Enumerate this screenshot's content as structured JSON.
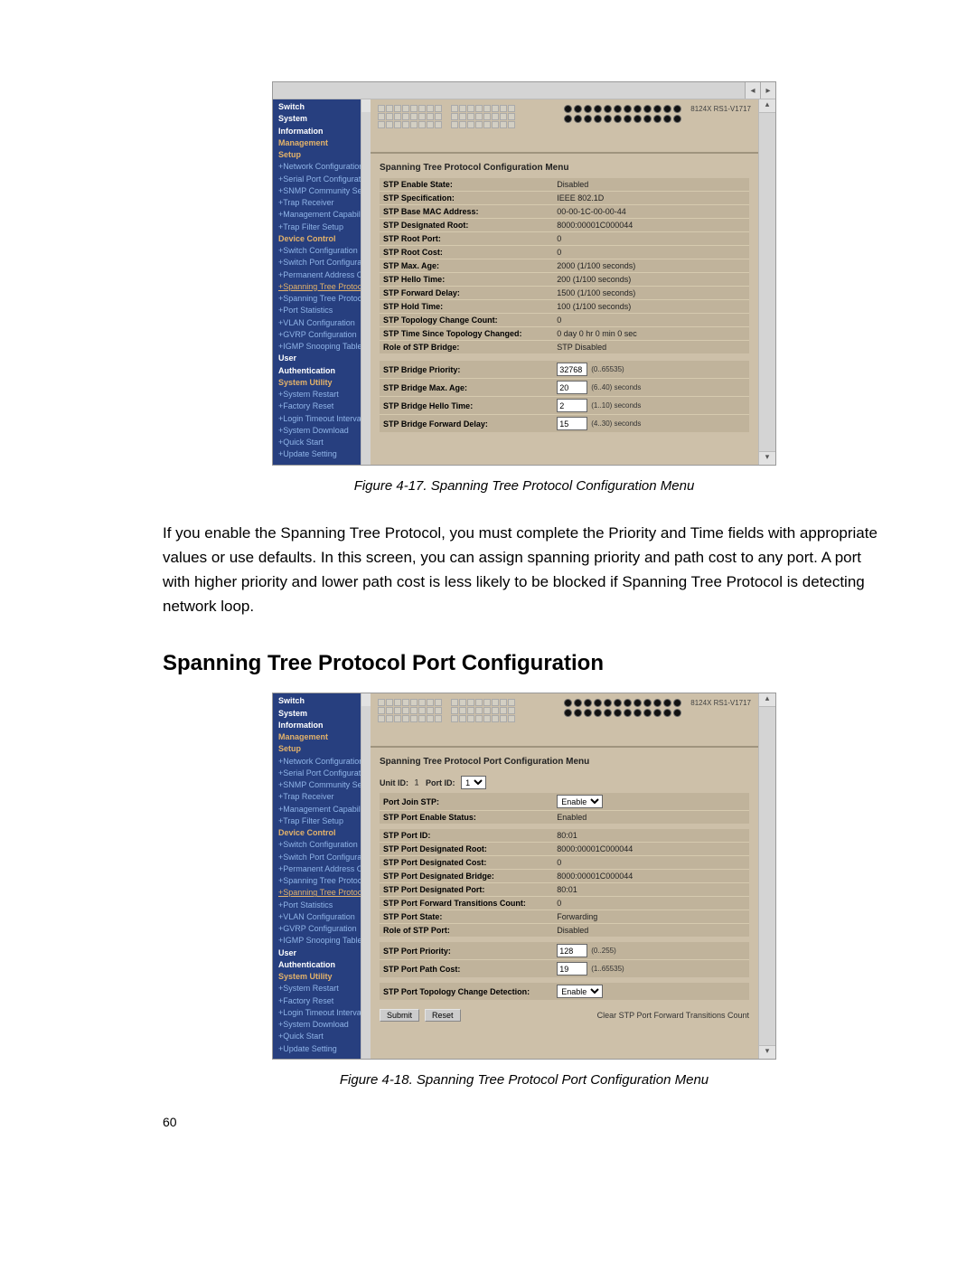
{
  "fig1": {
    "model_label": "8124X RS1-V1717",
    "sidebar_groups": [
      {
        "cls": "nav-head",
        "t": "Switch"
      },
      {
        "cls": "nav-head",
        "t": "System"
      },
      {
        "cls": "nav-head",
        "t": "Information"
      },
      {
        "cls": "nav-sub",
        "t": "Management"
      },
      {
        "cls": "nav-sub",
        "t": "Setup"
      },
      {
        "cls": "nav-link",
        "t": "+Network Configuration"
      },
      {
        "cls": "nav-link",
        "t": "+Serial Port Configuration"
      },
      {
        "cls": "nav-link",
        "t": "+SNMP Community Setup"
      },
      {
        "cls": "nav-link",
        "t": "+Trap Receiver"
      },
      {
        "cls": "nav-link",
        "t": "+Management Capability Setup"
      },
      {
        "cls": "nav-link",
        "t": "+Trap Filter Setup"
      },
      {
        "cls": "nav-sub",
        "t": "Device Control"
      },
      {
        "cls": "nav-link",
        "t": "+Switch Configuration"
      },
      {
        "cls": "nav-link",
        "t": "+Switch Port Configuration"
      },
      {
        "cls": "nav-link",
        "t": "+Permanent Address Configuration"
      },
      {
        "cls": "nav-active",
        "t": "+Spanning Tree Protocol Configuration"
      },
      {
        "cls": "nav-link",
        "t": "+Spanning Tree Protocol Port Configuration"
      },
      {
        "cls": "nav-link",
        "t": "+Port Statistics"
      },
      {
        "cls": "nav-link",
        "t": "+VLAN Configuration"
      },
      {
        "cls": "nav-link",
        "t": "+GVRP Configuration"
      },
      {
        "cls": "nav-link",
        "t": "+IGMP Snooping Table"
      },
      {
        "cls": "nav-head",
        "t": "User"
      },
      {
        "cls": "nav-head",
        "t": "Authentication"
      },
      {
        "cls": "nav-sub",
        "t": "System Utility"
      },
      {
        "cls": "nav-link",
        "t": "+System Restart"
      },
      {
        "cls": "nav-link",
        "t": "+Factory Reset"
      },
      {
        "cls": "nav-link",
        "t": "+Login Timeout Interval"
      },
      {
        "cls": "nav-link",
        "t": "+System Download"
      },
      {
        "cls": "nav-link",
        "t": "+Quick Start"
      },
      {
        "cls": "nav-link",
        "t": "+Update Setting"
      }
    ],
    "menu_title": "Spanning Tree Protocol Configuration Menu",
    "rows": [
      {
        "lbl": "STP Enable State:",
        "val": "Disabled"
      },
      {
        "lbl": "STP Specification:",
        "val": "IEEE 802.1D"
      },
      {
        "lbl": "STP Base MAC Address:",
        "val": "00-00-1C-00-00-44"
      },
      {
        "lbl": "STP Designated Root:",
        "val": "8000:00001C000044"
      },
      {
        "lbl": "STP Root Port:",
        "val": "0"
      },
      {
        "lbl": "STP Root Cost:",
        "val": "0"
      },
      {
        "lbl": "STP Max. Age:",
        "val": "2000  (1/100 seconds)"
      },
      {
        "lbl": "STP Hello Time:",
        "val": "200  (1/100 seconds)"
      },
      {
        "lbl": "STP Forward Delay:",
        "val": "1500  (1/100 seconds)"
      },
      {
        "lbl": "STP Hold Time:",
        "val": "100  (1/100 seconds)"
      },
      {
        "lbl": "STP Topology Change Count:",
        "val": "0"
      },
      {
        "lbl": "STP Time Since Topology Changed:",
        "val": "0 day 0 hr 0 min 0 sec"
      },
      {
        "lbl": "Role of STP Bridge:",
        "val": "STP Disabled"
      }
    ],
    "inputs": [
      {
        "lbl": "STP Bridge Priority:",
        "val": "32768",
        "hint": "(0..65535)"
      },
      {
        "lbl": "STP Bridge Max. Age:",
        "val": "20",
        "hint": "(6..40) seconds"
      },
      {
        "lbl": "STP Bridge Hello Time:",
        "val": "2",
        "hint": "(1..10) seconds"
      },
      {
        "lbl": "STP Bridge Forward Delay:",
        "val": "15",
        "hint": "(4..30) seconds"
      }
    ],
    "caption": "Figure 4-17. Spanning Tree Protocol Configuration Menu"
  },
  "paragraph": "If you enable the Spanning Tree Protocol, you must complete the Priority and Time fields with appropriate values or use defaults.  In this screen, you can assign spanning priority and path cost to any port.  A port with higher priority and lower path cost is less likely to be blocked if Spanning Tree Protocol is detecting network loop.",
  "section_heading": "Spanning Tree Protocol Port Configuration",
  "fig2": {
    "model_label": "8124X RS1-V1717",
    "sidebar_groups": [
      {
        "cls": "nav-head",
        "t": "Switch"
      },
      {
        "cls": "nav-head",
        "t": "System"
      },
      {
        "cls": "nav-head",
        "t": "Information"
      },
      {
        "cls": "nav-sub",
        "t": "Management"
      },
      {
        "cls": "nav-sub",
        "t": "Setup"
      },
      {
        "cls": "nav-link",
        "t": "+Network Configuration"
      },
      {
        "cls": "nav-link",
        "t": "+Serial Port Configuration"
      },
      {
        "cls": "nav-link",
        "t": "+SNMP Community Setup"
      },
      {
        "cls": "nav-link",
        "t": "+Trap Receiver"
      },
      {
        "cls": "nav-link",
        "t": "+Management Capability Setup"
      },
      {
        "cls": "nav-link",
        "t": "+Trap Filter Setup"
      },
      {
        "cls": "nav-sub",
        "t": "Device Control"
      },
      {
        "cls": "nav-link",
        "t": "+Switch Configuration"
      },
      {
        "cls": "nav-link",
        "t": "+Switch Port Configuration"
      },
      {
        "cls": "nav-link",
        "t": "+Permanent Address Configuration"
      },
      {
        "cls": "nav-link",
        "t": "+Spanning Tree Protocol Configuration"
      },
      {
        "cls": "nav-active",
        "t": "+Spanning Tree Protocol Port Configuration"
      },
      {
        "cls": "nav-link",
        "t": "+Port Statistics"
      },
      {
        "cls": "nav-link",
        "t": "+VLAN Configuration"
      },
      {
        "cls": "nav-link",
        "t": "+GVRP Configuration"
      },
      {
        "cls": "nav-link",
        "t": "+IGMP Snooping Table"
      },
      {
        "cls": "nav-head",
        "t": "User"
      },
      {
        "cls": "nav-head",
        "t": "Authentication"
      },
      {
        "cls": "nav-sub",
        "t": "System Utility"
      },
      {
        "cls": "nav-link",
        "t": "+System Restart"
      },
      {
        "cls": "nav-link",
        "t": "+Factory Reset"
      },
      {
        "cls": "nav-link",
        "t": "+Login Timeout Interval"
      },
      {
        "cls": "nav-link",
        "t": "+System Download"
      },
      {
        "cls": "nav-link",
        "t": "+Quick Start"
      },
      {
        "cls": "nav-link",
        "t": "+Update Setting"
      }
    ],
    "menu_title": "Spanning Tree Protocol Port Configuration Menu",
    "unit_lbl": "Unit ID:",
    "unit_val": "1",
    "port_lbl": "Port ID:",
    "port_sel": "1",
    "join_lbl": "Port Join STP:",
    "join_sel": "Enable",
    "enable_status_lbl": "STP Port Enable Status:",
    "enable_status_val": "Enabled",
    "rows": [
      {
        "lbl": "STP Port ID:",
        "val": "80:01"
      },
      {
        "lbl": "STP Port Designated Root:",
        "val": "8000:00001C000044"
      },
      {
        "lbl": "STP Port Designated Cost:",
        "val": "0"
      },
      {
        "lbl": "STP Port Designated Bridge:",
        "val": "8000:00001C000044"
      },
      {
        "lbl": "STP Port Designated Port:",
        "val": "80:01"
      },
      {
        "lbl": "STP Port Forward Transitions Count:",
        "val": "0"
      },
      {
        "lbl": "STP Port State:",
        "val": "Forwarding"
      },
      {
        "lbl": "Role of STP Port:",
        "val": "Disabled"
      }
    ],
    "inputs": [
      {
        "lbl": "STP Port Priority:",
        "val": "128",
        "hint": "(0..255)"
      },
      {
        "lbl": "STP Port Path Cost:",
        "val": "19",
        "hint": "(1..65535)"
      }
    ],
    "topo_lbl": "STP Port Topology Change Detection:",
    "topo_sel": "Enable",
    "submit": "Submit",
    "reset": "Reset",
    "clear": "Clear STP Port Forward Transitions Count",
    "caption": "Figure 4-18. Spanning Tree Protocol Port Configuration Menu"
  },
  "page_number": "60"
}
